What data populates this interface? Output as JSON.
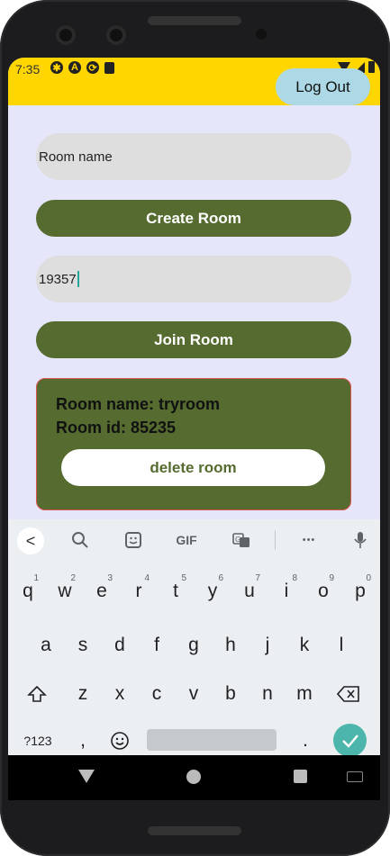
{
  "status_bar": {
    "time": "7:35"
  },
  "app_bar": {
    "logout_label": "Log Out"
  },
  "form": {
    "room_name_placeholder": "Room name",
    "room_id_value": "19357",
    "create_label": "Create Room",
    "join_label": "Join Room"
  },
  "room_card": {
    "name_line": "Room name: tryroom",
    "id_line": "Room id: 85235",
    "delete_label": "delete room"
  },
  "keyboard": {
    "toolbar": {
      "back": "<",
      "gif": "GIF",
      "more": "•••"
    },
    "row1": [
      {
        "k": "q",
        "h": "1"
      },
      {
        "k": "w",
        "h": "2"
      },
      {
        "k": "e",
        "h": "3"
      },
      {
        "k": "r",
        "h": "4"
      },
      {
        "k": "t",
        "h": "5"
      },
      {
        "k": "y",
        "h": "6"
      },
      {
        "k": "u",
        "h": "7"
      },
      {
        "k": "i",
        "h": "8"
      },
      {
        "k": "o",
        "h": "9"
      },
      {
        "k": "p",
        "h": "0"
      }
    ],
    "row2": [
      "a",
      "s",
      "d",
      "f",
      "g",
      "h",
      "j",
      "k",
      "l"
    ],
    "row3": [
      "z",
      "x",
      "c",
      "v",
      "b",
      "n",
      "m"
    ],
    "sym_label": "?123",
    "comma": ",",
    "period": ".",
    "colors": {
      "accent": "#4db6ac",
      "key_text": "#202124"
    }
  },
  "theme": {
    "app_bar": "#ffd600",
    "background": "#e6e6fa",
    "primary_button": "#556b2f",
    "logout_button": "#add8e6",
    "card_border": "#d9534f"
  }
}
